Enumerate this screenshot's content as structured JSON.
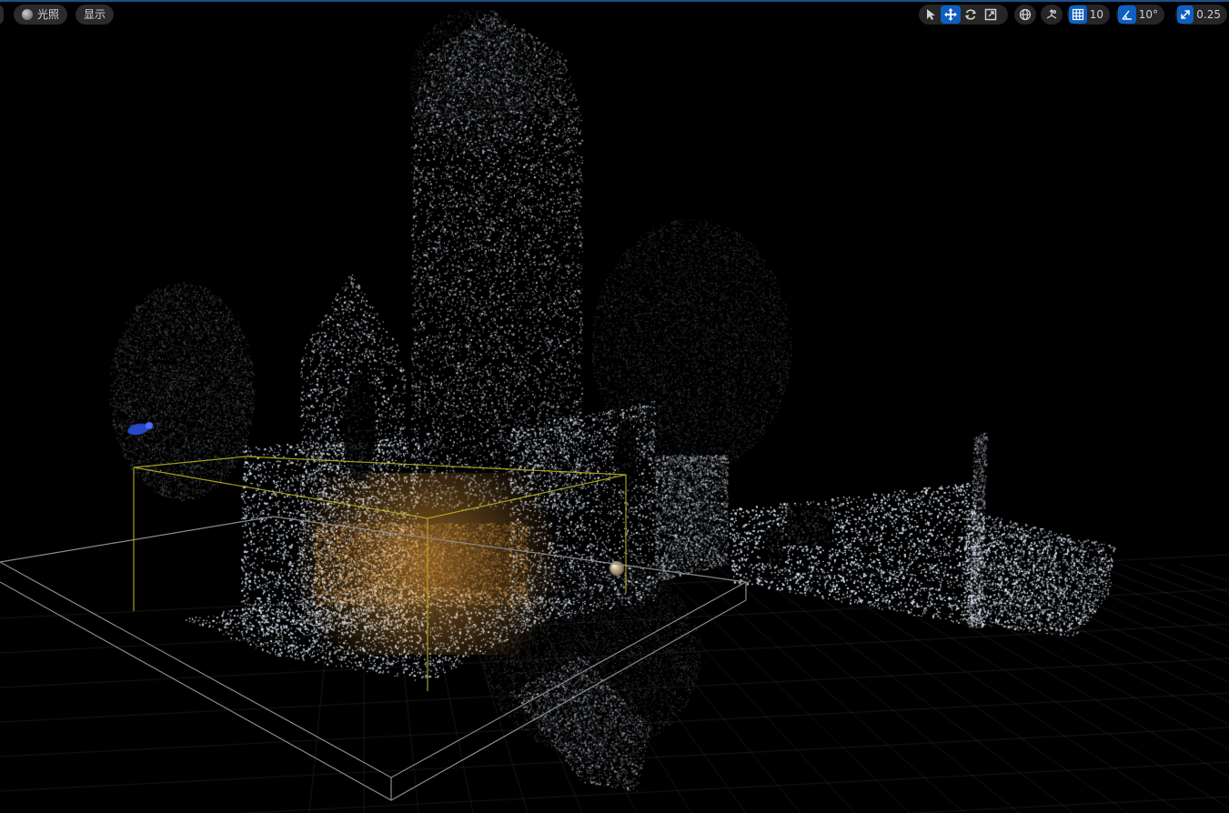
{
  "left_toolbar": {
    "lighting_label": "光照",
    "show_label": "显示"
  },
  "right_toolbar": {
    "grid_snap_value": "10",
    "rotation_snap_value": "10°",
    "scale_snap_value": "0.25"
  },
  "colors": {
    "accent": "#0e5fc2",
    "background": "#000000",
    "point_cloud": "#dfe8f5",
    "selection_box": "#c8c020",
    "warm_light": "#e8a040"
  },
  "icons": {
    "select": "cursor-icon",
    "translate": "move-icon",
    "rotate": "rotate-icon",
    "scale": "scale-icon",
    "world": "globe-icon",
    "surface_snap": "surface-snap-icon",
    "grid": "grid-icon",
    "angle": "angle-icon",
    "scale_snap": "diagonal-arrow-icon",
    "light_sphere": "sphere-icon"
  }
}
